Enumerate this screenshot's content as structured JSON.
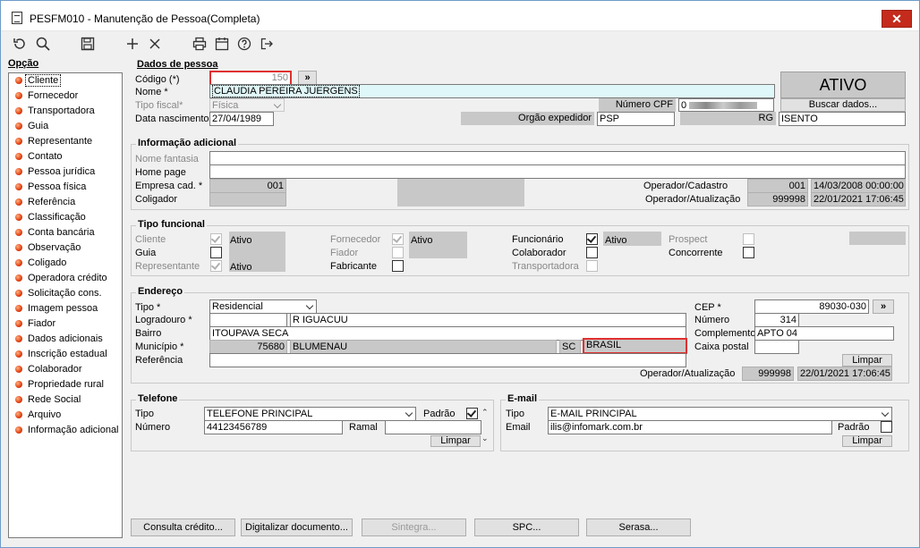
{
  "window": {
    "title": "PESFM010 - Manutenção de Pessoa(Completa)",
    "close_label": "✕"
  },
  "toolbar": {
    "icons": [
      "refresh-icon",
      "search-icon",
      "save-icon",
      "add-icon",
      "delete-icon",
      "print-icon",
      "calendar-icon",
      "help-icon",
      "exit-icon"
    ]
  },
  "sidebar": {
    "header": "Opção",
    "items": [
      {
        "label": "Cliente"
      },
      {
        "label": "Fornecedor"
      },
      {
        "label": "Transportadora"
      },
      {
        "label": "Guia"
      },
      {
        "label": "Representante"
      },
      {
        "label": "Contato"
      },
      {
        "label": "Pessoa jurídica"
      },
      {
        "label": "Pessoa física"
      },
      {
        "label": "Referência"
      },
      {
        "label": "Classificação"
      },
      {
        "label": "Conta bancária"
      },
      {
        "label": "Observação"
      },
      {
        "label": "Coligado"
      },
      {
        "label": "Operadora crédito"
      },
      {
        "label": "Solicitação cons."
      },
      {
        "label": "Imagem pessoa"
      },
      {
        "label": "Fiador"
      },
      {
        "label": "Dados adicionais"
      },
      {
        "label": "Inscrição estadual"
      },
      {
        "label": "Colaborador"
      },
      {
        "label": "Propriedade rural"
      },
      {
        "label": "Rede Social"
      },
      {
        "label": "Arquivo"
      },
      {
        "label": "Informação adicional"
      }
    ]
  },
  "dados": {
    "group_label": "Dados de pessoa",
    "codigo_label": "Código (*)",
    "codigo_value": "150",
    "codigo_btn": "»",
    "nome_label": "Nome *",
    "nome_value": "CLAUDIA PEREIRA JUERGENS",
    "tipo_fiscal_label": "Tipo fiscal*",
    "tipo_fiscal_value": "Física",
    "numero_cpf_label": "Número CPF",
    "cpf_value": "0",
    "data_nasc_label": "Data nascimento",
    "data_nasc_value": "27/04/1989",
    "orgao_label": "Orgão expedidor",
    "orgao_value": "PSP",
    "rg_label": "RG",
    "rg_value": "ISENTO",
    "status": "ATIVO",
    "buscar_label": "Buscar dados..."
  },
  "info": {
    "group_label": "Informação adicional",
    "nome_fantasia_label": "Nome fantasia",
    "home_page_label": "Home page",
    "empresa_label": "Empresa cad. *",
    "empresa_value": "001",
    "coligador_label": "Coligador",
    "op_cad_label": "Operador/Cadastro",
    "op_cad_code": "001",
    "op_cad_date": "14/03/2008 00:00:00",
    "op_atu_label": "Operador/Atualização",
    "op_atu_code": "999998",
    "op_atu_date": "22/01/2021 17:06:45"
  },
  "funcional": {
    "group_label": "Tipo funcional",
    "cliente": "Cliente",
    "cliente_status": "Ativo",
    "guia": "Guia",
    "representante": "Representante",
    "representante_status": "Ativo",
    "fornecedor": "Fornecedor",
    "fornecedor_status": "Ativo",
    "fiador": "Fiador",
    "fabricante": "Fabricante",
    "funcionario": "Funcionário",
    "funcionario_status": "Ativo",
    "colaborador": "Colaborador",
    "transportadora": "Transportadora",
    "prospect": "Prospect",
    "concorrente": "Concorrente"
  },
  "endereco": {
    "group_label": "Endereço",
    "tipo_label": "Tipo *",
    "tipo_value": "Residencial",
    "logradouro_label": "Logradouro *",
    "logradouro_value": "R IGUACUU",
    "bairro_label": "Bairro",
    "bairro_value": "ITOUPAVA SECA",
    "municipio_label": "Município *",
    "municipio_code": "75680",
    "municipio_value": "BLUMENAU",
    "uf": "SC",
    "pais": "BRASIL",
    "referencia_label": "Referência",
    "cep_label": "CEP *",
    "cep_value": "89030-030",
    "cep_btn": "»",
    "numero_label": "Número",
    "numero_value": "314",
    "complemento_label": "Complemento",
    "complemento_value": "APTO 04",
    "caixa_label": "Caixa postal",
    "limpar": "Limpar",
    "op_atu_label": "Operador/Atualização",
    "op_atu_code": "999998",
    "op_atu_date": "22/01/2021 17:06:45"
  },
  "telefone": {
    "group_label": "Telefone",
    "tipo_label": "Tipo",
    "tipo_value": "TELEFONE PRINCIPAL",
    "padrao_label": "Padrão",
    "numero_label": "Número",
    "numero_value": "44123456789",
    "ramal_label": "Ramal",
    "limpar": "Limpar"
  },
  "email": {
    "group_label": "E-mail",
    "tipo_label": "Tipo",
    "tipo_value": "E-MAIL PRINCIPAL",
    "email_label": "Email",
    "email_value": "ilis@infomark.com.br",
    "padrao_label": "Padrão",
    "limpar": "Limpar"
  },
  "bottom": {
    "consulta": "Consulta crédito...",
    "digitalizar": "Digitalizar documento...",
    "sintegra": "Sintegra...",
    "spc": "SPC...",
    "serasa": "Serasa..."
  }
}
